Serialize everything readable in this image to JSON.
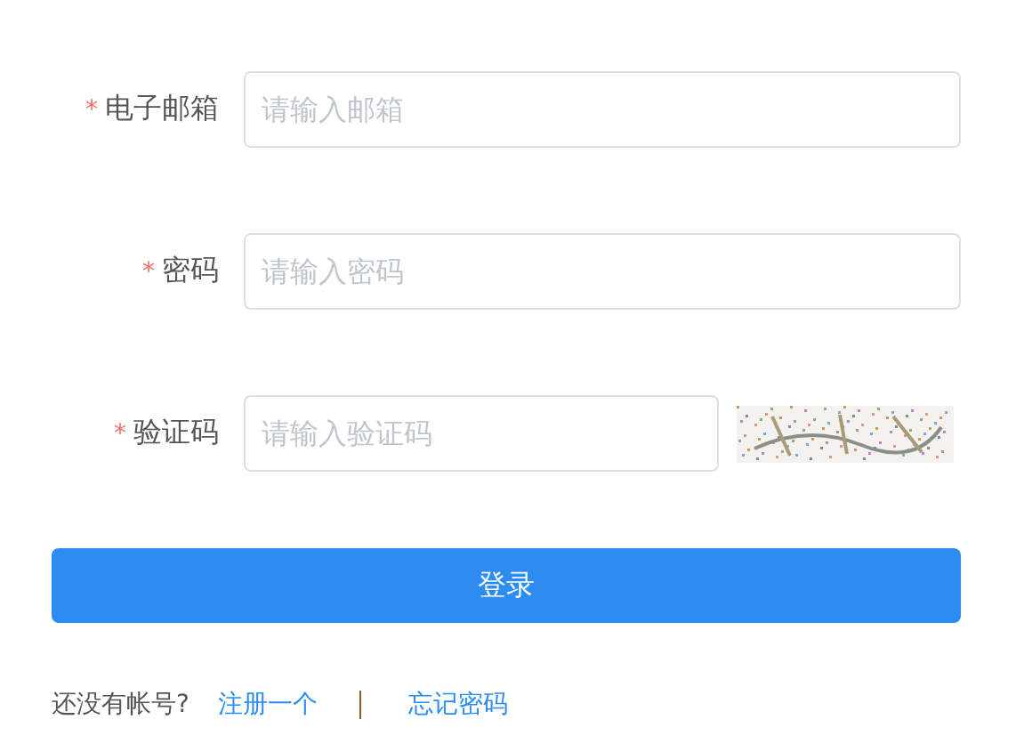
{
  "fields": [
    {
      "label": "电子邮箱",
      "mark": "*",
      "placeholder": "请输入邮箱",
      "kind": "text"
    },
    {
      "label": "密码",
      "mark": "*",
      "placeholder": "请输入密码",
      "kind": "password"
    },
    {
      "label": "验证码",
      "mark": "*",
      "placeholder": "请输入验证码",
      "kind": "captcha"
    }
  ],
  "login_button": "登录",
  "footer": {
    "prompt": "还没有帐号?",
    "register_link": "注册一个",
    "forgot_link": "忘记密码"
  }
}
